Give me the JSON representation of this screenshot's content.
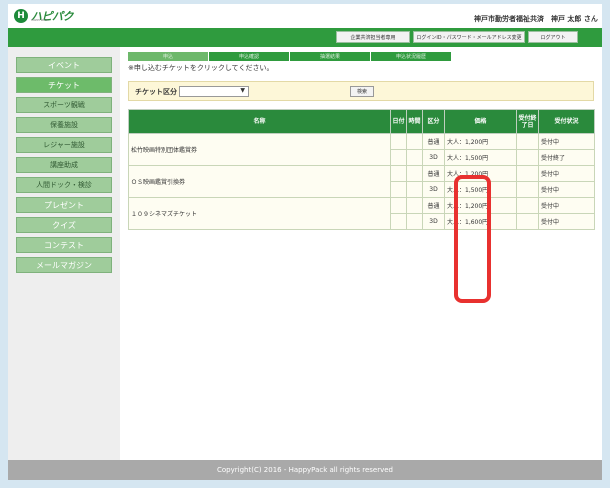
{
  "header": {
    "logo_mark": "H",
    "logo_text": "ハピパク",
    "logo_sub": "HAPPYPACK",
    "org_user": "神戸市勤労者福祉共済　神戸 太郎 さん"
  },
  "top_links": [
    "企業共済担当者専用",
    "ログインID・パスワード・メールアドレス変更",
    "ログアウト"
  ],
  "sidebar": {
    "items": [
      "イベント",
      "チケット",
      "スポーツ観戦",
      "保養施設",
      "レジャー施設",
      "講座助成",
      "人間ドック・検診",
      "プレゼント",
      "クイズ",
      "コンテスト",
      "メールマガジン"
    ]
  },
  "tabs": [
    "申込",
    "申込確認",
    "抽選結果",
    "申込状況履歴"
  ],
  "instruction": "※申し込むチケットをクリックしてください。",
  "filter": {
    "label": "チケット区分",
    "selected": "",
    "search_label": "検索"
  },
  "table": {
    "headers": {
      "name": "名称",
      "date": "日付",
      "time": "時間",
      "genre": "区分",
      "price": "価格",
      "deadline": "受付終了日",
      "status": "受付状況"
    },
    "rows": [
      {
        "name": "松竹映画特別団体鑑賞券",
        "genres": [
          "普通",
          "3D"
        ],
        "prices": [
          "大人：1,200円",
          "大人：1,500円"
        ],
        "statuses": [
          "受付中",
          "受付終了"
        ]
      },
      {
        "name": "ＯＳ映画鑑賞引換券",
        "genres": [
          "普通",
          "3D"
        ],
        "prices": [
          "大人：1,200円",
          "大人：1,500円"
        ],
        "statuses": [
          "受付中",
          "受付中"
        ]
      },
      {
        "name": "１０９シネマズチケット",
        "genres": [
          "普通",
          "3D"
        ],
        "prices": [
          "大人：1,200円",
          "大人：1,600円"
        ],
        "statuses": [
          "受付中",
          "受付中"
        ]
      }
    ]
  },
  "footer": "Copyright(C) 2016 - HappyPack all rights reserved",
  "colors": {
    "brand_green": "#2f9b3e",
    "sidebar_green": "#9fcc9b",
    "highlight_red": "#e8312f"
  },
  "icons": {
    "dropdown": "chevron-down-icon"
  }
}
